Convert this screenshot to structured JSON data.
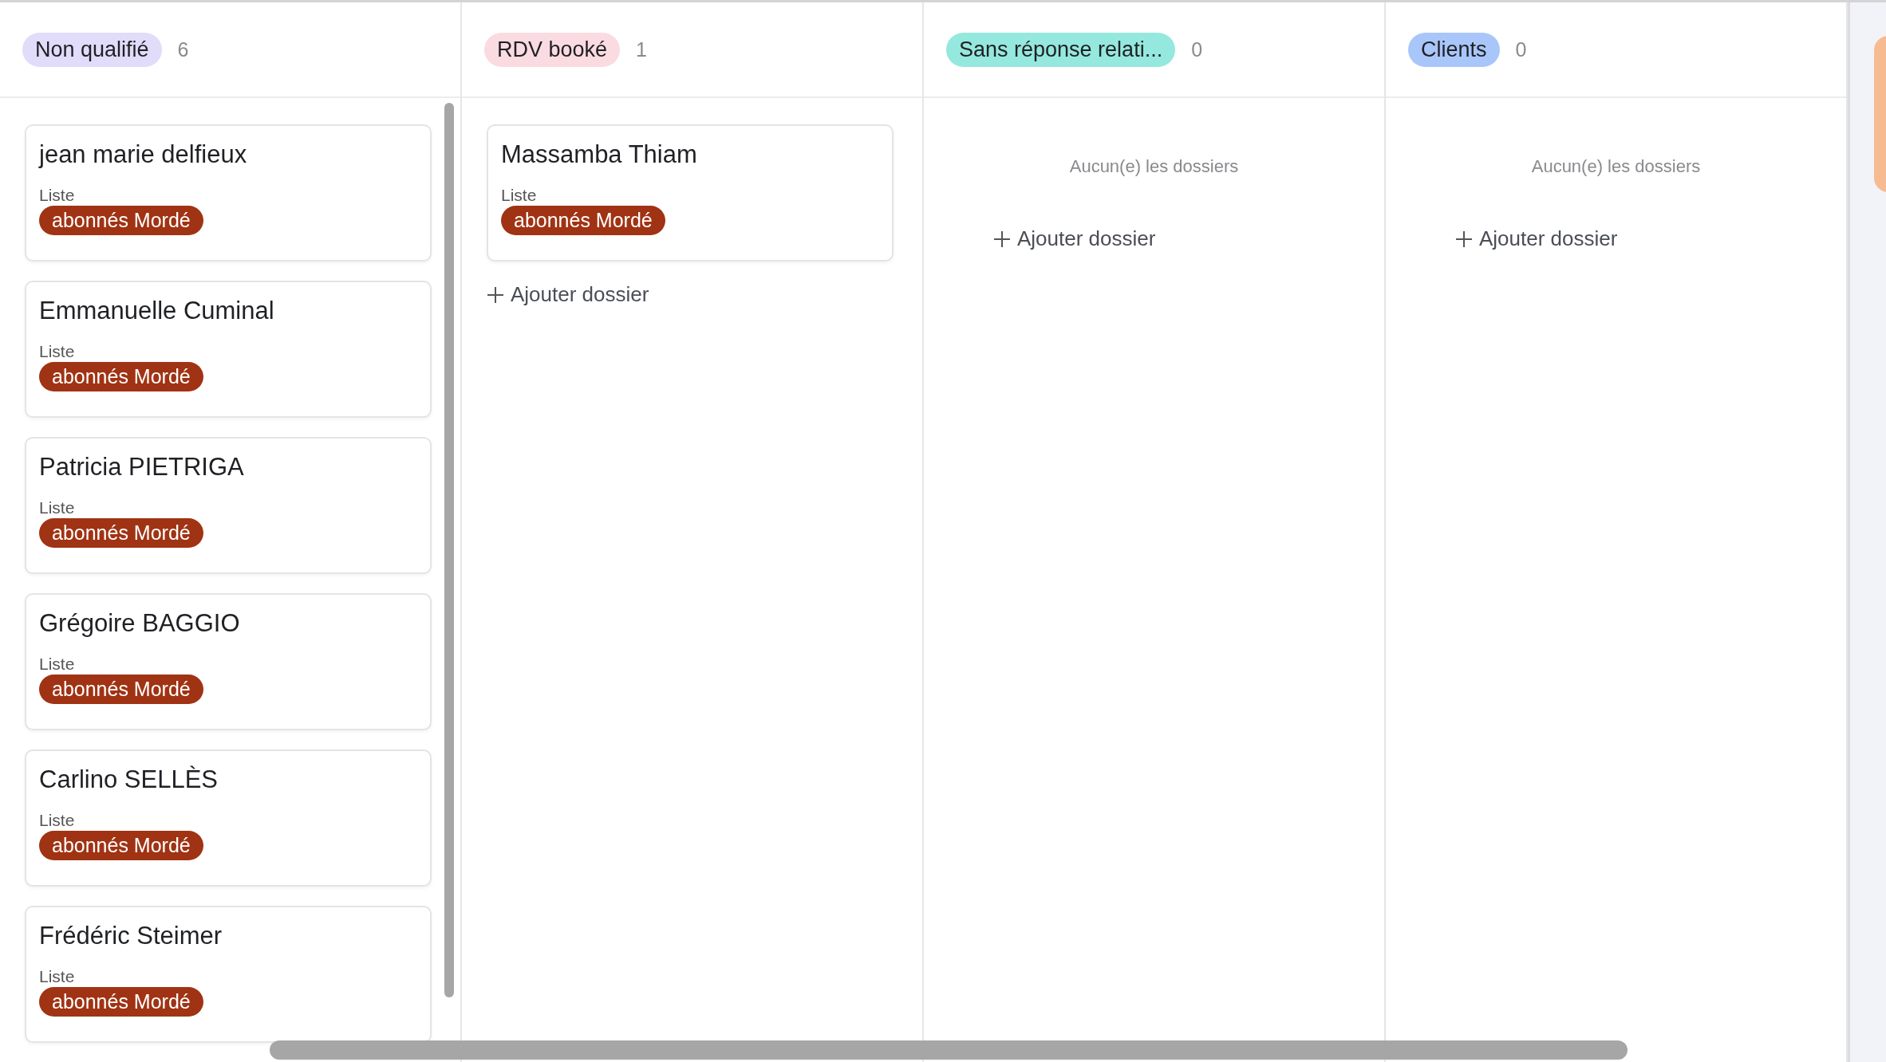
{
  "columns": [
    {
      "title": "Non qualifié",
      "color": "#e0dcfa",
      "count": "6",
      "cards": [
        {
          "name": "jean marie delfieux",
          "field_label": "Liste",
          "tag": "abonnés Mordé"
        },
        {
          "name": "Emmanuelle Cuminal",
          "field_label": "Liste",
          "tag": "abonnés Mordé"
        },
        {
          "name": "Patricia PIETRIGA",
          "field_label": "Liste",
          "tag": "abonnés Mordé"
        },
        {
          "name": "Grégoire BAGGIO",
          "field_label": "Liste",
          "tag": "abonnés Mordé"
        },
        {
          "name": "Carlino SELLÈS",
          "field_label": "Liste",
          "tag": "abonnés Mordé"
        },
        {
          "name": "Frédéric Steimer",
          "field_label": "Liste",
          "tag": "abonnés Mordé"
        }
      ]
    },
    {
      "title": "RDV booké",
      "color": "#fadbe1",
      "count": "1",
      "cards": [
        {
          "name": "Massamba Thiam",
          "field_label": "Liste",
          "tag": "abonnés Mordé"
        }
      ],
      "add_label": "Ajouter dossier"
    },
    {
      "title": "Sans réponse relati...",
      "color": "#95e8dd",
      "count": "0",
      "empty_text": "Aucun(e) les dossiers",
      "add_label": "Ajouter dossier"
    },
    {
      "title": "Clients",
      "color": "#a9c6fa",
      "count": "0",
      "empty_text": "Aucun(e) les dossiers",
      "add_label": "Ajouter dossier"
    }
  ]
}
